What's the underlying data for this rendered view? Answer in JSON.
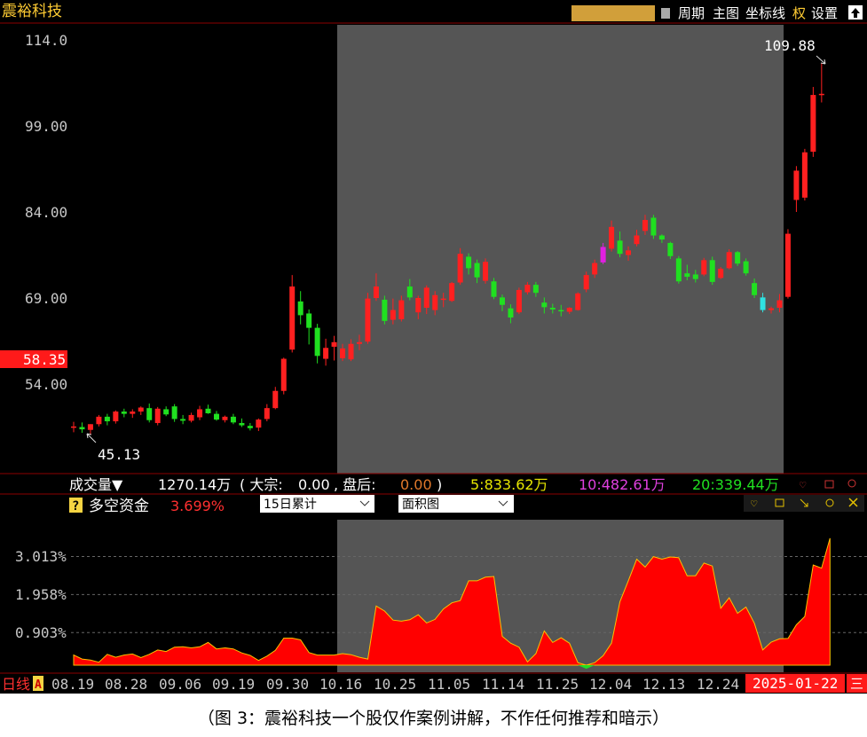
{
  "header": {
    "stock_name": "震裕科技",
    "menu": [
      "周期",
      "主图",
      "坐标线",
      "权",
      "设置"
    ]
  },
  "price_chart": {
    "y_ticks": [
      "114.0",
      "99.00",
      "84.00",
      "69.00",
      "54.00"
    ],
    "y_tick_values": [
      114,
      99,
      84,
      69,
      54
    ],
    "current_price_label": "58.35",
    "current_price": 58.35,
    "high_label": "109.88",
    "low_label": "45.13"
  },
  "volume_bar": {
    "label": "成交量▼",
    "value": "1270.14万",
    "dazong_label": "( 大宗:",
    "dazong_value": "0.00",
    "panhou_label": ", 盘后:",
    "panhou_value": "0.00",
    "panhou_close": ")",
    "ma5": "5:833.62万",
    "ma10": "10:482.61万",
    "ma20": "20:339.44万"
  },
  "indicator_panel": {
    "help": "?",
    "title": "多空资金",
    "value": "3.699%",
    "select1": "15日累计",
    "select2": "面积图",
    "y_ticks": [
      "3.013%",
      "1.958%",
      "0.903%"
    ],
    "y_tick_values": [
      3.013,
      1.958,
      0.903
    ]
  },
  "x_axis": {
    "period_label": "日线",
    "period_badge": "A",
    "dates": [
      "08.19",
      "08.28",
      "09.06",
      "09.19",
      "09.30",
      "10.16",
      "10.25",
      "11.05",
      "11.14",
      "11.25",
      "12.04",
      "12.13",
      "12.24"
    ],
    "last_date": "2025-01-22",
    "end_label": "三"
  },
  "caption": "（图 3：震裕科技一个股仅作案例讲解，不作任何推荐和暗示）",
  "colors": {
    "up": "#ff2020",
    "down": "#20e020",
    "highlight_bg": "#555555",
    "axis_red": "#c00000",
    "tick_text": "#c8c8c8",
    "ma5": "#e6e600",
    "ma10": "#e040e0",
    "ma20": "#20e020"
  },
  "chart_data": {
    "type": "candlestick",
    "ylim": [
      42,
      118
    ],
    "candles": [
      {
        "o": 46.6,
        "h": 47.4,
        "l": 45.6,
        "c": 46.6
      },
      {
        "o": 46.5,
        "h": 47.3,
        "l": 45.5,
        "c": 46.1
      },
      {
        "o": 46.0,
        "h": 47.0,
        "l": 45.13,
        "c": 47.0
      },
      {
        "o": 47.0,
        "h": 48.6,
        "l": 46.6,
        "c": 48.3
      },
      {
        "o": 48.3,
        "h": 48.8,
        "l": 46.8,
        "c": 47.5
      },
      {
        "o": 47.5,
        "h": 49.4,
        "l": 47.1,
        "c": 49.2
      },
      {
        "o": 49.2,
        "h": 49.7,
        "l": 48.2,
        "c": 48.8
      },
      {
        "o": 48.8,
        "h": 49.6,
        "l": 48.1,
        "c": 49.2
      },
      {
        "o": 49.2,
        "h": 50.1,
        "l": 48.6,
        "c": 49.9
      },
      {
        "o": 49.8,
        "h": 50.6,
        "l": 47.3,
        "c": 47.7
      },
      {
        "o": 47.2,
        "h": 50.0,
        "l": 46.8,
        "c": 49.7
      },
      {
        "o": 49.6,
        "h": 50.1,
        "l": 48.4,
        "c": 48.7
      },
      {
        "o": 50.1,
        "h": 50.5,
        "l": 47.4,
        "c": 47.9
      },
      {
        "o": 47.9,
        "h": 48.6,
        "l": 47.0,
        "c": 47.6
      },
      {
        "o": 47.6,
        "h": 49.0,
        "l": 47.3,
        "c": 48.6
      },
      {
        "o": 48.2,
        "h": 50.2,
        "l": 47.7,
        "c": 49.6
      },
      {
        "o": 49.7,
        "h": 50.4,
        "l": 48.8,
        "c": 48.9
      },
      {
        "o": 48.8,
        "h": 49.3,
        "l": 47.6,
        "c": 47.8
      },
      {
        "o": 47.7,
        "h": 48.5,
        "l": 47.3,
        "c": 48.3
      },
      {
        "o": 48.3,
        "h": 48.8,
        "l": 47.0,
        "c": 47.3
      },
      {
        "o": 47.2,
        "h": 48.0,
        "l": 46.5,
        "c": 46.8
      },
      {
        "o": 46.7,
        "h": 47.2,
        "l": 45.9,
        "c": 46.3
      },
      {
        "o": 46.4,
        "h": 48.0,
        "l": 45.8,
        "c": 47.8
      },
      {
        "o": 47.9,
        "h": 50.5,
        "l": 47.5,
        "c": 49.8
      },
      {
        "o": 49.8,
        "h": 53.5,
        "l": 49.6,
        "c": 52.8
      },
      {
        "o": 52.8,
        "h": 58.6,
        "l": 52.2,
        "c": 58.4
      },
      {
        "o": 60.0,
        "h": 73.0,
        "l": 59.5,
        "c": 71.0
      },
      {
        "o": 68.4,
        "h": 70.2,
        "l": 64.4,
        "c": 66.0
      },
      {
        "o": 66.3,
        "h": 67.0,
        "l": 60.9,
        "c": 63.8
      },
      {
        "o": 63.8,
        "h": 64.5,
        "l": 57.6,
        "c": 58.9
      },
      {
        "o": 58.4,
        "h": 61.9,
        "l": 57.2,
        "c": 60.3
      },
      {
        "o": 60.5,
        "h": 62.4,
        "l": 58.1,
        "c": 61.3
      },
      {
        "o": 58.5,
        "h": 61.0,
        "l": 58.0,
        "c": 60.2
      },
      {
        "o": 58.3,
        "h": 61.8,
        "l": 58.0,
        "c": 61.0
      },
      {
        "o": 61.0,
        "h": 62.6,
        "l": 59.9,
        "c": 61.3
      },
      {
        "o": 61.4,
        "h": 69.9,
        "l": 61.0,
        "c": 68.9
      },
      {
        "o": 69.0,
        "h": 73.3,
        "l": 68.5,
        "c": 71.0
      },
      {
        "o": 68.7,
        "h": 69.4,
        "l": 64.4,
        "c": 65.0
      },
      {
        "o": 65.2,
        "h": 68.9,
        "l": 64.4,
        "c": 66.9
      },
      {
        "o": 65.3,
        "h": 69.4,
        "l": 64.9,
        "c": 68.6
      },
      {
        "o": 71.0,
        "h": 72.3,
        "l": 68.6,
        "c": 69.1
      },
      {
        "o": 66.5,
        "h": 69.4,
        "l": 65.3,
        "c": 69.0
      },
      {
        "o": 67.3,
        "h": 71.2,
        "l": 66.2,
        "c": 70.8
      },
      {
        "o": 66.9,
        "h": 70.2,
        "l": 66.0,
        "c": 69.5
      },
      {
        "o": 68.7,
        "h": 69.9,
        "l": 67.4,
        "c": 68.9
      },
      {
        "o": 68.5,
        "h": 71.8,
        "l": 68.3,
        "c": 71.6
      },
      {
        "o": 71.7,
        "h": 77.7,
        "l": 71.3,
        "c": 76.7
      },
      {
        "o": 76.2,
        "h": 76.8,
        "l": 73.1,
        "c": 74.2
      },
      {
        "o": 75.1,
        "h": 75.7,
        "l": 71.6,
        "c": 72.6
      },
      {
        "o": 72.0,
        "h": 75.9,
        "l": 71.5,
        "c": 75.3
      },
      {
        "o": 71.9,
        "h": 72.5,
        "l": 68.8,
        "c": 69.2
      },
      {
        "o": 69.1,
        "h": 69.6,
        "l": 66.7,
        "c": 67.8
      },
      {
        "o": 67.2,
        "h": 67.9,
        "l": 64.6,
        "c": 65.6
      },
      {
        "o": 66.5,
        "h": 70.8,
        "l": 66.2,
        "c": 70.4
      },
      {
        "o": 70.0,
        "h": 71.8,
        "l": 69.6,
        "c": 71.3
      },
      {
        "o": 71.3,
        "h": 71.8,
        "l": 69.2,
        "c": 69.9
      },
      {
        "o": 68.2,
        "h": 69.1,
        "l": 66.3,
        "c": 67.4
      },
      {
        "o": 67.3,
        "h": 68.0,
        "l": 66.3,
        "c": 67.0
      },
      {
        "o": 66.9,
        "h": 67.8,
        "l": 65.8,
        "c": 66.7
      },
      {
        "o": 66.6,
        "h": 67.4,
        "l": 66.2,
        "c": 67.3
      },
      {
        "o": 66.9,
        "h": 70.0,
        "l": 66.8,
        "c": 69.8
      },
      {
        "o": 70.5,
        "h": 73.6,
        "l": 70.0,
        "c": 73.0
      },
      {
        "o": 73.1,
        "h": 75.7,
        "l": 72.5,
        "c": 75.1
      },
      {
        "o": 75.2,
        "h": 78.6,
        "l": 74.9,
        "c": 77.9
      },
      {
        "o": 77.6,
        "h": 82.5,
        "l": 77.1,
        "c": 81.4
      },
      {
        "o": 79.0,
        "h": 80.6,
        "l": 76.1,
        "c": 76.7
      },
      {
        "o": 76.5,
        "h": 78.0,
        "l": 75.5,
        "c": 77.3
      },
      {
        "o": 78.4,
        "h": 80.9,
        "l": 78.0,
        "c": 79.9
      },
      {
        "o": 80.7,
        "h": 83.5,
        "l": 80.0,
        "c": 82.6
      },
      {
        "o": 83.0,
        "h": 83.5,
        "l": 79.3,
        "c": 79.9
      },
      {
        "o": 79.9,
        "h": 80.1,
        "l": 78.6,
        "c": 79.2
      },
      {
        "o": 78.6,
        "h": 78.8,
        "l": 75.8,
        "c": 76.3
      },
      {
        "o": 75.9,
        "h": 76.3,
        "l": 71.5,
        "c": 71.9
      },
      {
        "o": 73.3,
        "h": 74.8,
        "l": 72.1,
        "c": 72.7
      },
      {
        "o": 73.1,
        "h": 73.9,
        "l": 71.7,
        "c": 72.3
      },
      {
        "o": 73.1,
        "h": 76.0,
        "l": 72.8,
        "c": 75.6
      },
      {
        "o": 75.6,
        "h": 76.2,
        "l": 71.3,
        "c": 71.8
      },
      {
        "o": 72.5,
        "h": 74.4,
        "l": 72.3,
        "c": 74.1
      },
      {
        "o": 74.2,
        "h": 77.5,
        "l": 74.0,
        "c": 77.0
      },
      {
        "o": 77.0,
        "h": 77.2,
        "l": 74.6,
        "c": 75.0
      },
      {
        "o": 75.4,
        "h": 75.9,
        "l": 72.9,
        "c": 73.3
      },
      {
        "o": 71.6,
        "h": 72.4,
        "l": 69.0,
        "c": 69.5
      },
      {
        "o": 69.1,
        "h": 69.9,
        "l": 66.5,
        "c": 66.9
      },
      {
        "o": 66.9,
        "h": 67.5,
        "l": 66.3,
        "c": 67.2
      },
      {
        "o": 67.3,
        "h": 69.7,
        "l": 66.5,
        "c": 68.6
      },
      {
        "o": 69.2,
        "h": 81.0,
        "l": 68.9,
        "c": 80.2
      },
      {
        "o": 86.1,
        "h": 92.0,
        "l": 84.0,
        "c": 91.2
      },
      {
        "o": 86.5,
        "h": 95.0,
        "l": 86.0,
        "c": 94.4
      },
      {
        "o": 94.5,
        "h": 105.8,
        "l": 93.6,
        "c": 104.4
      },
      {
        "o": 104.5,
        "h": 109.88,
        "l": 103.1,
        "c": 104.6
      }
    ],
    "highlight_range": [
      32,
      84
    ],
    "indicator": {
      "name": "多空资金",
      "type": "area",
      "ylim": [
        -0.1,
        3.6
      ],
      "values": [
        0.28,
        0.17,
        0.14,
        0.08,
        0.3,
        0.22,
        0.28,
        0.31,
        0.21,
        0.3,
        0.42,
        0.38,
        0.5,
        0.51,
        0.48,
        0.51,
        0.63,
        0.45,
        0.48,
        0.45,
        0.34,
        0.27,
        0.13,
        0.25,
        0.41,
        0.75,
        0.75,
        0.7,
        0.35,
        0.28,
        0.28,
        0.28,
        0.32,
        0.29,
        0.22,
        0.17,
        1.64,
        1.5,
        1.25,
        1.22,
        1.26,
        1.4,
        1.17,
        1.27,
        1.56,
        1.73,
        1.79,
        2.34,
        2.34,
        2.44,
        2.46,
        0.8,
        0.61,
        0.5,
        0.09,
        0.32,
        0.95,
        0.63,
        0.76,
        0.61,
        0.07,
        -0.1,
        0.07,
        0.26,
        0.61,
        1.76,
        2.34,
        2.94,
        2.72,
        3.01,
        2.94,
        3.0,
        2.98,
        2.48,
        2.48,
        2.83,
        2.75,
        1.58,
        1.87,
        1.44,
        1.61,
        1.16,
        0.42,
        0.64,
        0.73,
        0.74,
        1.12,
        1.35,
        2.78,
        2.69,
        3.52
      ]
    }
  }
}
